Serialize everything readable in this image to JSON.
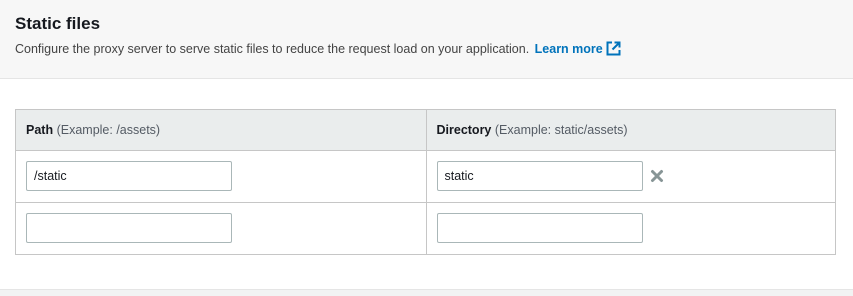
{
  "panel": {
    "title": "Static files",
    "description": "Configure the proxy server to serve static files to reduce the request load on your application.",
    "learn_more": "Learn more"
  },
  "table": {
    "columns": [
      {
        "label": "Path",
        "hint": "(Example: /assets)"
      },
      {
        "label": "Directory",
        "hint": "(Example: static/assets)"
      }
    ],
    "rows": [
      {
        "path": "/static",
        "directory": "static",
        "removable": true
      },
      {
        "path": "",
        "directory": "",
        "removable": false
      }
    ]
  },
  "icons": {
    "learn_more": "external-link-icon",
    "remove": "close-icon"
  },
  "colors": {
    "link": "#0073bb",
    "header_bg": "#f7f7f7",
    "table_header_bg": "#eaeded",
    "remove_icon": "#879596"
  }
}
